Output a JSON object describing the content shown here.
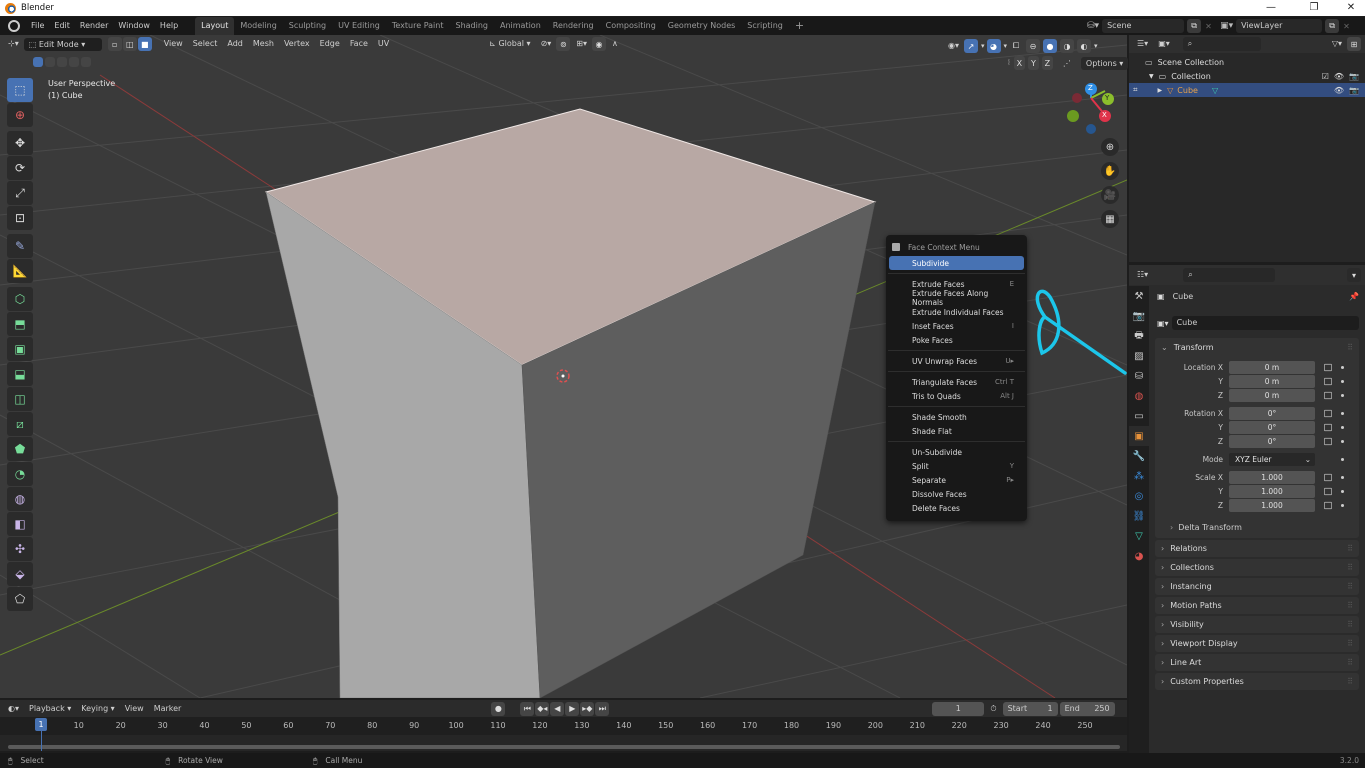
{
  "window": {
    "title": "Blender",
    "minimize": "—",
    "maximize": "❐",
    "close": "✕"
  },
  "menubar": {
    "menus": [
      "File",
      "Edit",
      "Render",
      "Window",
      "Help"
    ],
    "workspaces": [
      "Layout",
      "Modeling",
      "Sculpting",
      "UV Editing",
      "Texture Paint",
      "Shading",
      "Animation",
      "Rendering",
      "Compositing",
      "Geometry Nodes",
      "Scripting"
    ],
    "active_workspace": "Layout",
    "add_workspace": "+",
    "scene": "Scene",
    "view_layer": "ViewLayer"
  },
  "viewport_header": {
    "mode": "Edit Mode",
    "menus": [
      "View",
      "Select",
      "Add",
      "Mesh",
      "Vertex",
      "Edge",
      "Face",
      "UV"
    ],
    "transform_orientation": "Global",
    "axes": [
      "X",
      "Y",
      "Z"
    ],
    "options": "Options"
  },
  "viewport": {
    "perspective": "User Perspective",
    "object_label": "(1) Cube",
    "gizmo": {
      "z": "Z",
      "y": "Y",
      "x": "X"
    }
  },
  "context_menu": {
    "title": "Face Context Menu",
    "groups": [
      [
        {
          "label": "Subdivide",
          "shortcut": "",
          "highlighted": true
        }
      ],
      [
        {
          "label": "Extrude Faces",
          "shortcut": "E"
        },
        {
          "label": "Extrude Faces Along Normals",
          "shortcut": ""
        },
        {
          "label": "Extrude Individual Faces",
          "shortcut": ""
        },
        {
          "label": "Inset Faces",
          "shortcut": "I"
        },
        {
          "label": "Poke Faces",
          "shortcut": ""
        }
      ],
      [
        {
          "label": "UV Unwrap Faces",
          "shortcut": "U▸"
        }
      ],
      [
        {
          "label": "Triangulate Faces",
          "shortcut": "Ctrl T"
        },
        {
          "label": "Tris to Quads",
          "shortcut": "Alt J"
        }
      ],
      [
        {
          "label": "Shade Smooth",
          "shortcut": ""
        },
        {
          "label": "Shade Flat",
          "shortcut": ""
        }
      ],
      [
        {
          "label": "Un-Subdivide",
          "shortcut": ""
        },
        {
          "label": "Split",
          "shortcut": "Y"
        },
        {
          "label": "Separate",
          "shortcut": "P▸"
        },
        {
          "label": "Dissolve Faces",
          "shortcut": ""
        },
        {
          "label": "Delete Faces",
          "shortcut": ""
        }
      ]
    ]
  },
  "outliner": {
    "search_placeholder": "",
    "items": [
      {
        "label": "Scene Collection"
      },
      {
        "label": "Collection"
      },
      {
        "label": "Cube",
        "selected": true
      }
    ]
  },
  "properties": {
    "object_name": "Cube",
    "datablock_name": "Cube",
    "transform": {
      "title": "Transform",
      "location": {
        "label": "Location X",
        "x": "0 m",
        "y": "0 m",
        "z": "0 m"
      },
      "rotation": {
        "label": "Rotation X",
        "x": "0°",
        "y": "0°",
        "z": "0°"
      },
      "mode_label": "Mode",
      "mode": "XYZ Euler",
      "scale": {
        "label": "Scale X",
        "x": "1.000",
        "y": "1.000",
        "z": "1.000"
      },
      "y_label": "Y",
      "z_label": "Z"
    },
    "subpanel": "Delta Transform",
    "panels": [
      "Relations",
      "Collections",
      "Instancing",
      "Motion Paths",
      "Visibility",
      "Viewport Display",
      "Line Art",
      "Custom Properties"
    ]
  },
  "timeline": {
    "menus": [
      "Playback",
      "Keying",
      "View",
      "Marker"
    ],
    "current_frame": "1",
    "start_label": "Start",
    "start": "1",
    "end_label": "End",
    "end": "250",
    "ticks": [
      "10",
      "20",
      "30",
      "40",
      "50",
      "60",
      "70",
      "80",
      "90",
      "100",
      "110",
      "120",
      "130",
      "140",
      "150",
      "160",
      "170",
      "180",
      "190",
      "200",
      "210",
      "220",
      "230",
      "240",
      "250"
    ]
  },
  "statusbar": {
    "select": "Select",
    "rotate": "Rotate View",
    "call_menu": "Call Menu",
    "version": "3.2.0"
  },
  "colors": {
    "accent": "#4772b3",
    "annotation": "#1cc6ea",
    "cube_top": "#b8a8a4",
    "axis_x": "#e0334a",
    "axis_y": "#8bbe2c",
    "axis_z": "#2f8fe6"
  }
}
